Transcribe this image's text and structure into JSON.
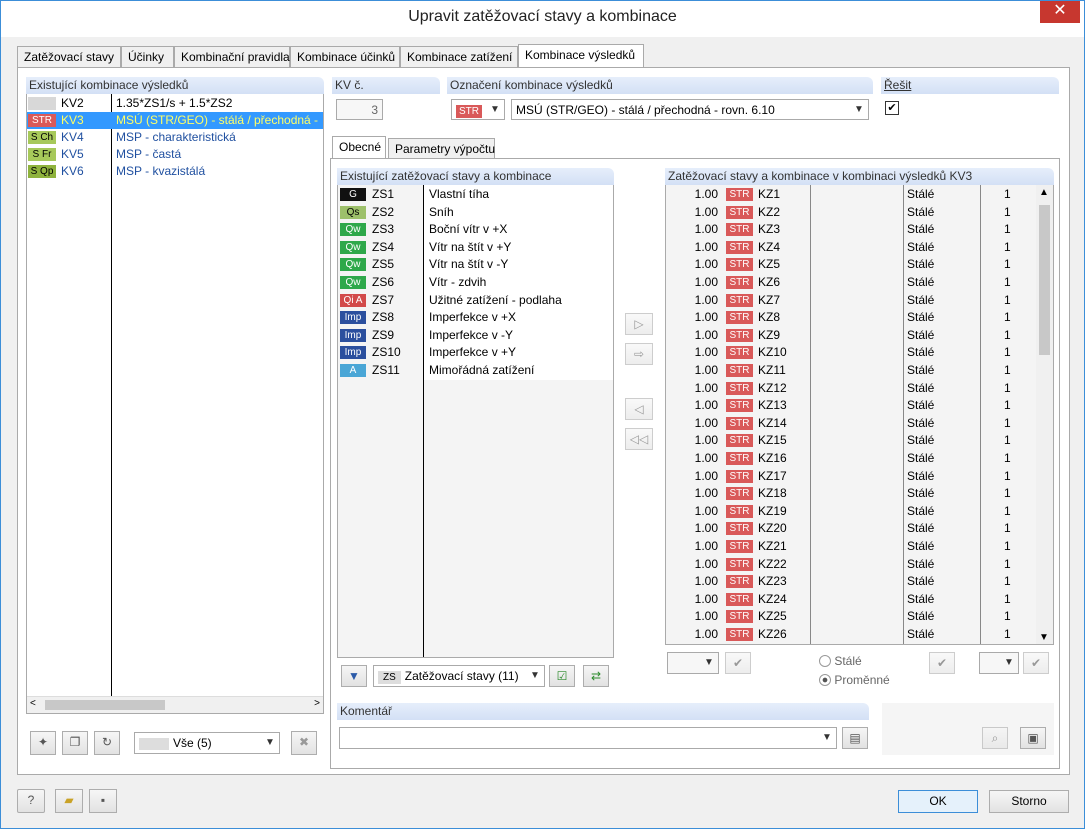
{
  "window": {
    "title": "Upravit zatěžovací stavy a kombinace",
    "close_glyph": "✕"
  },
  "tabs": [
    "Zatěžovací stavy",
    "Účinky",
    "Kombinační pravidla",
    "Kombinace účinků",
    "Kombinace zatížení",
    "Kombinace výsledků"
  ],
  "left": {
    "header": "Existující kombinace výsledků",
    "items": [
      {
        "badge": "",
        "badge_color": "#d8d8d8",
        "id": "KV2",
        "desc": "1.35*ZS1/s + 1.5*ZS2"
      },
      {
        "badge": "STR",
        "badge_color": "#d95959",
        "id": "KV3",
        "desc": "MSÚ (STR/GEO) - stálá / přechodná -"
      },
      {
        "badge": "S Ch",
        "badge_color": "#a7c95a",
        "id": "KV4",
        "desc": "MSP - charakteristická"
      },
      {
        "badge": "S Fr",
        "badge_color": "#a7c95a",
        "id": "KV5",
        "desc": "MSP - častá"
      },
      {
        "badge": "S Qp",
        "badge_color": "#8fb33d",
        "id": "KV6",
        "desc": "MSP - kvazistálá"
      }
    ],
    "filter_value": "Vše (5)"
  },
  "kv": {
    "label": "KV č.",
    "value": "3"
  },
  "oznaceni": {
    "label": "Označení kombinace výsledků",
    "badge": "STR",
    "value": "MSÚ (STR/GEO) - stálá / přechodná - rovn. 6.10"
  },
  "resit": {
    "label": "Řešit",
    "check": "✔"
  },
  "subtabs": [
    "Obecné",
    "Parametry výpočtu"
  ],
  "loadcases": {
    "header": "Existující zatěžovací stavy a kombinace",
    "items": [
      {
        "badge": "G",
        "color": "#111111",
        "id": "ZS1",
        "name": "Vlastní tíha"
      },
      {
        "badge": "Qs",
        "color": "#9dc06a",
        "id": "ZS2",
        "name": "Sníh"
      },
      {
        "badge": "Qw",
        "color": "#2ea84a",
        "id": "ZS3",
        "name": "Boční vítr v +X"
      },
      {
        "badge": "Qw",
        "color": "#2ea84a",
        "id": "ZS4",
        "name": "Vítr na štít v +Y"
      },
      {
        "badge": "Qw",
        "color": "#2ea84a",
        "id": "ZS5",
        "name": "Vítr na štít v -Y"
      },
      {
        "badge": "Qw",
        "color": "#2ea84a",
        "id": "ZS6",
        "name": "Vítr - zdvih"
      },
      {
        "badge": "Qi A",
        "color": "#d24a4a",
        "id": "ZS7",
        "name": "Užitné zatížení - podlaha"
      },
      {
        "badge": "Imp",
        "color": "#2b4f9e",
        "id": "ZS8",
        "name": "Imperfekce v +X"
      },
      {
        "badge": "Imp",
        "color": "#2b4f9e",
        "id": "ZS9",
        "name": "Imperfekce v -Y"
      },
      {
        "badge": "Imp",
        "color": "#2b4f9e",
        "id": "ZS10",
        "name": "Imperfekce v +Y"
      },
      {
        "badge": "A",
        "color": "#4aa6d6",
        "id": "ZS11",
        "name": "Mimořádná zatížení"
      }
    ],
    "filter_tag": "ZS",
    "filter_value": "Zatěžovací stavy (11)"
  },
  "combo": {
    "header": "Zatěžovací stavy a kombinace v kombinaci výsledků KV3",
    "rows": [
      {
        "factor": "1.00",
        "badge": "STR",
        "id": "KZ1",
        "type": "Stálé",
        "group": "1"
      },
      {
        "factor": "1.00",
        "badge": "STR",
        "id": "KZ2",
        "type": "Stálé",
        "group": "1"
      },
      {
        "factor": "1.00",
        "badge": "STR",
        "id": "KZ3",
        "type": "Stálé",
        "group": "1"
      },
      {
        "factor": "1.00",
        "badge": "STR",
        "id": "KZ4",
        "type": "Stálé",
        "group": "1"
      },
      {
        "factor": "1.00",
        "badge": "STR",
        "id": "KZ5",
        "type": "Stálé",
        "group": "1"
      },
      {
        "factor": "1.00",
        "badge": "STR",
        "id": "KZ6",
        "type": "Stálé",
        "group": "1"
      },
      {
        "factor": "1.00",
        "badge": "STR",
        "id": "KZ7",
        "type": "Stálé",
        "group": "1"
      },
      {
        "factor": "1.00",
        "badge": "STR",
        "id": "KZ8",
        "type": "Stálé",
        "group": "1"
      },
      {
        "factor": "1.00",
        "badge": "STR",
        "id": "KZ9",
        "type": "Stálé",
        "group": "1"
      },
      {
        "factor": "1.00",
        "badge": "STR",
        "id": "KZ10",
        "type": "Stálé",
        "group": "1"
      },
      {
        "factor": "1.00",
        "badge": "STR",
        "id": "KZ11",
        "type": "Stálé",
        "group": "1"
      },
      {
        "factor": "1.00",
        "badge": "STR",
        "id": "KZ12",
        "type": "Stálé",
        "group": "1"
      },
      {
        "factor": "1.00",
        "badge": "STR",
        "id": "KZ13",
        "type": "Stálé",
        "group": "1"
      },
      {
        "factor": "1.00",
        "badge": "STR",
        "id": "KZ14",
        "type": "Stálé",
        "group": "1"
      },
      {
        "factor": "1.00",
        "badge": "STR",
        "id": "KZ15",
        "type": "Stálé",
        "group": "1"
      },
      {
        "factor": "1.00",
        "badge": "STR",
        "id": "KZ16",
        "type": "Stálé",
        "group": "1"
      },
      {
        "factor": "1.00",
        "badge": "STR",
        "id": "KZ17",
        "type": "Stálé",
        "group": "1"
      },
      {
        "factor": "1.00",
        "badge": "STR",
        "id": "KZ18",
        "type": "Stálé",
        "group": "1"
      },
      {
        "factor": "1.00",
        "badge": "STR",
        "id": "KZ19",
        "type": "Stálé",
        "group": "1"
      },
      {
        "factor": "1.00",
        "badge": "STR",
        "id": "KZ20",
        "type": "Stálé",
        "group": "1"
      },
      {
        "factor": "1.00",
        "badge": "STR",
        "id": "KZ21",
        "type": "Stálé",
        "group": "1"
      },
      {
        "factor": "1.00",
        "badge": "STR",
        "id": "KZ22",
        "type": "Stálé",
        "group": "1"
      },
      {
        "factor": "1.00",
        "badge": "STR",
        "id": "KZ23",
        "type": "Stálé",
        "group": "1"
      },
      {
        "factor": "1.00",
        "badge": "STR",
        "id": "KZ24",
        "type": "Stálé",
        "group": "1"
      },
      {
        "factor": "1.00",
        "badge": "STR",
        "id": "KZ25",
        "type": "Stálé",
        "group": "1"
      },
      {
        "factor": "1.00",
        "badge": "STR",
        "id": "KZ26",
        "type": "Stálé",
        "group": "1"
      }
    ],
    "radio_stale": "Stálé",
    "radio_promenne": "Proměnné"
  },
  "komentar": {
    "label": "Komentář",
    "value": ""
  },
  "footer": {
    "ok": "OK",
    "cancel": "Storno"
  }
}
